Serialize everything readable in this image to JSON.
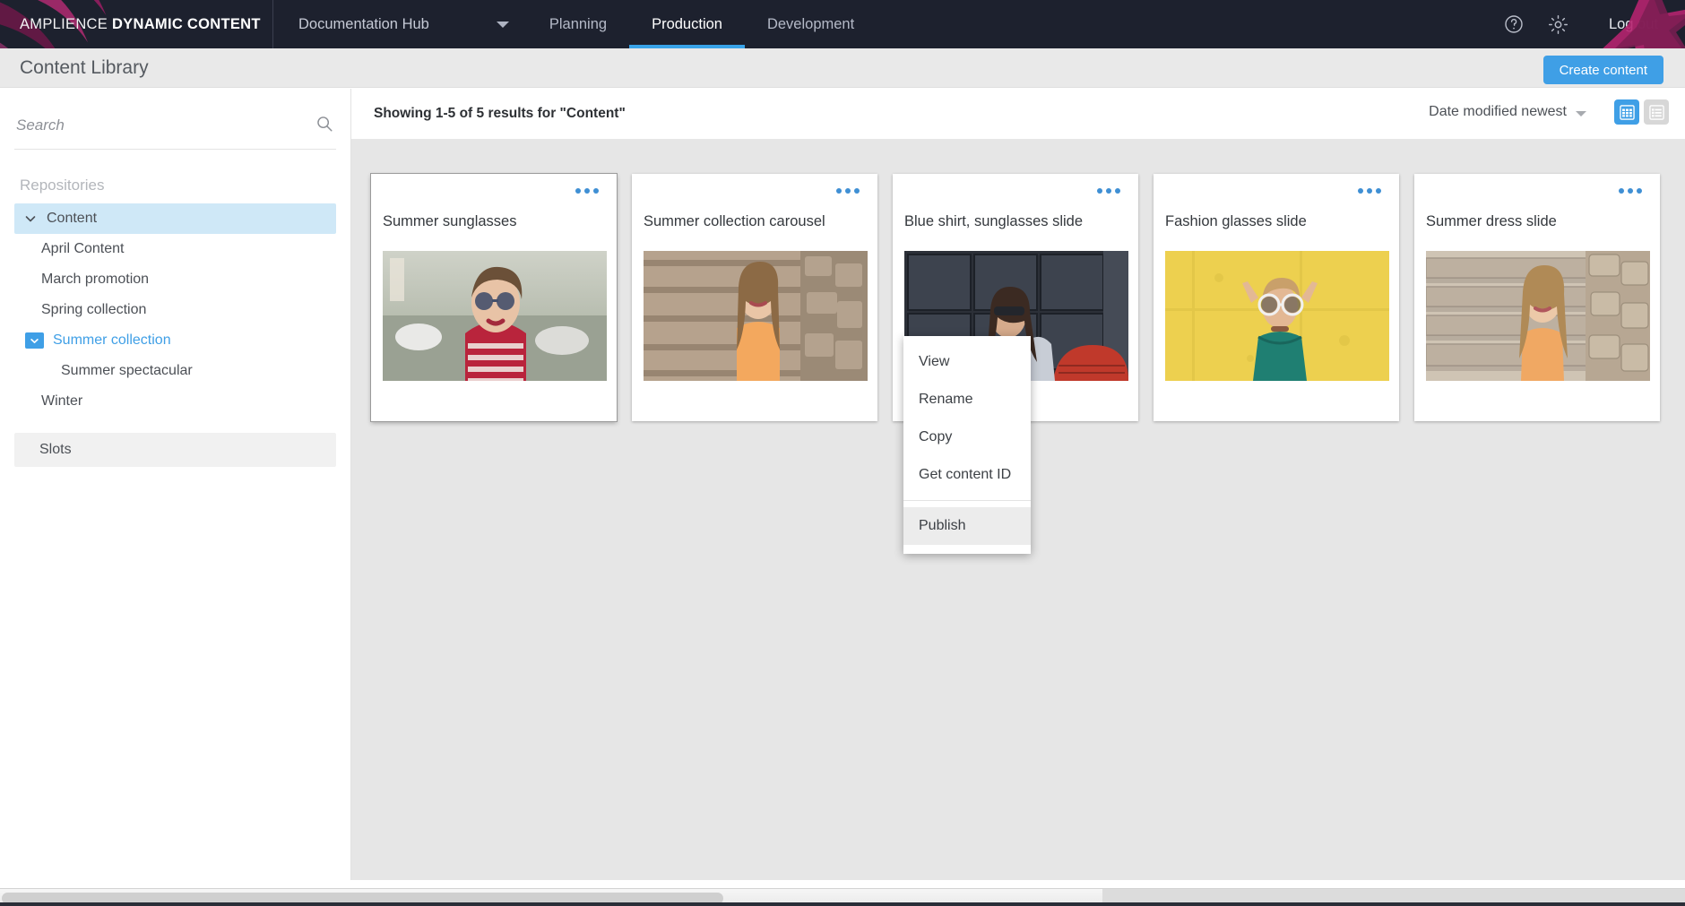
{
  "topnav": {
    "brand_light": "AMPLIENCE ",
    "brand_bold": "DYNAMIC CONTENT",
    "hub_label": "Documentation Hub",
    "tabs": [
      {
        "label": "Planning",
        "active": false
      },
      {
        "label": "Production",
        "active": true
      },
      {
        "label": "Development",
        "active": false
      }
    ],
    "help_icon": "help-circle-icon",
    "settings_icon": "gear-icon",
    "logout_label": "Log out",
    "accent_color": "#39a3e8",
    "background_color": "#1d212e"
  },
  "pageheader": {
    "title": "Content Library",
    "create_button": "Create content",
    "button_color": "#3f9fe6"
  },
  "sidebar": {
    "search_placeholder": "Search",
    "search_value": "",
    "search_icon": "search-icon",
    "repositories_label": "Repositories",
    "tree": [
      {
        "label": "Content",
        "level": 0,
        "selected": true,
        "chevron": "chevron-down",
        "highlight": false
      },
      {
        "label": "April Content",
        "level": 1,
        "selected": false,
        "chevron": "",
        "highlight": false
      },
      {
        "label": "March promotion",
        "level": 1,
        "selected": false,
        "chevron": "",
        "highlight": false
      },
      {
        "label": "Spring collection",
        "level": 1,
        "selected": false,
        "chevron": "",
        "highlight": false
      },
      {
        "label": "Summer collection",
        "level": 1,
        "selected": false,
        "chevron": "folder-open-badge",
        "highlight": true
      },
      {
        "label": "Summer spectacular",
        "level": 2,
        "selected": false,
        "chevron": "",
        "highlight": false
      },
      {
        "label": "Winter",
        "level": 1,
        "selected": false,
        "chevron": "",
        "highlight": false
      }
    ],
    "slots_label": "Slots"
  },
  "main": {
    "results_text": "Showing 1-5 of 5 results for \"Content\"",
    "sort_label": "Date modified newest",
    "grid_view_icon": "grid-view-icon",
    "list_view_icon": "list-view-icon",
    "grid_view_active": true,
    "cards": [
      {
        "title": "Summer sunglasses",
        "menu_icon": "more-options-icon",
        "thumb": "woman-sunglasses-street",
        "active": true
      },
      {
        "title": "Summer collection carousel",
        "menu_icon": "more-options-icon",
        "thumb": "woman-orange-dress-stairs",
        "active": false
      },
      {
        "title": "Blue shirt, sunglasses slide",
        "menu_icon": "more-options-icon",
        "thumb": "woman-cafe-blue-shirt",
        "active": false
      },
      {
        "title": "Fashion glasses slide",
        "menu_icon": "more-options-icon",
        "thumb": "woman-yellow-wall-glasses",
        "active": false
      },
      {
        "title": "Summer dress slide",
        "menu_icon": "more-options-icon",
        "thumb": "woman-steps-orange-top",
        "active": false
      }
    ]
  },
  "context_menu": {
    "items": [
      {
        "label": "View",
        "hover": false
      },
      {
        "label": "Rename",
        "hover": false
      },
      {
        "label": "Copy",
        "hover": false
      },
      {
        "label": "Get content ID",
        "hover": false
      }
    ],
    "publish": {
      "label": "Publish",
      "hover": true
    }
  }
}
